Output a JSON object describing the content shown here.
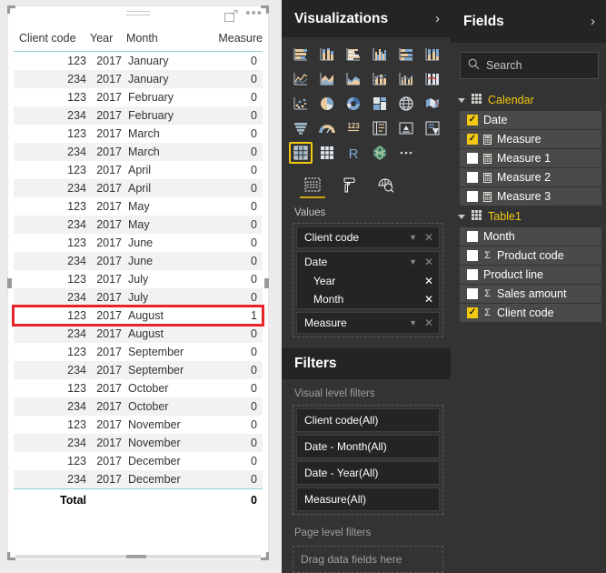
{
  "visual": {
    "name": "table-visual",
    "header_icons": [
      "focus-mode-icon",
      "more-options-icon"
    ],
    "columns": [
      "Client code",
      "Year",
      "Month",
      "Measure"
    ],
    "rows": [
      {
        "client": "123",
        "year": "2017",
        "month": "January",
        "measure": "0",
        "highlighted": false
      },
      {
        "client": "234",
        "year": "2017",
        "month": "January",
        "measure": "0",
        "highlighted": false
      },
      {
        "client": "123",
        "year": "2017",
        "month": "February",
        "measure": "0",
        "highlighted": false
      },
      {
        "client": "234",
        "year": "2017",
        "month": "February",
        "measure": "0",
        "highlighted": false
      },
      {
        "client": "123",
        "year": "2017",
        "month": "March",
        "measure": "0",
        "highlighted": false
      },
      {
        "client": "234",
        "year": "2017",
        "month": "March",
        "measure": "0",
        "highlighted": false
      },
      {
        "client": "123",
        "year": "2017",
        "month": "April",
        "measure": "0",
        "highlighted": false
      },
      {
        "client": "234",
        "year": "2017",
        "month": "April",
        "measure": "0",
        "highlighted": false
      },
      {
        "client": "123",
        "year": "2017",
        "month": "May",
        "measure": "0",
        "highlighted": false
      },
      {
        "client": "234",
        "year": "2017",
        "month": "May",
        "measure": "0",
        "highlighted": false
      },
      {
        "client": "123",
        "year": "2017",
        "month": "June",
        "measure": "0",
        "highlighted": false
      },
      {
        "client": "234",
        "year": "2017",
        "month": "June",
        "measure": "0",
        "highlighted": false
      },
      {
        "client": "123",
        "year": "2017",
        "month": "July",
        "measure": "0",
        "highlighted": false
      },
      {
        "client": "234",
        "year": "2017",
        "month": "July",
        "measure": "0",
        "highlighted": false
      },
      {
        "client": "123",
        "year": "2017",
        "month": "August",
        "measure": "1",
        "highlighted": true
      },
      {
        "client": "234",
        "year": "2017",
        "month": "August",
        "measure": "0",
        "highlighted": false
      },
      {
        "client": "123",
        "year": "2017",
        "month": "September",
        "measure": "0",
        "highlighted": false
      },
      {
        "client": "234",
        "year": "2017",
        "month": "September",
        "measure": "0",
        "highlighted": false
      },
      {
        "client": "123",
        "year": "2017",
        "month": "October",
        "measure": "0",
        "highlighted": false
      },
      {
        "client": "234",
        "year": "2017",
        "month": "October",
        "measure": "0",
        "highlighted": false
      },
      {
        "client": "123",
        "year": "2017",
        "month": "November",
        "measure": "0",
        "highlighted": false
      },
      {
        "client": "234",
        "year": "2017",
        "month": "November",
        "measure": "0",
        "highlighted": false
      },
      {
        "client": "123",
        "year": "2017",
        "month": "December",
        "measure": "0",
        "highlighted": false
      },
      {
        "client": "234",
        "year": "2017",
        "month": "December",
        "measure": "0",
        "highlighted": false
      }
    ],
    "total": {
      "label": "Total",
      "measure": "0"
    },
    "highlight_color": "#e8242a",
    "header_rule_color": "#8fd0d0"
  },
  "visualizations": {
    "title": "Visualizations",
    "collapse_icon": "chevron-right-icon",
    "selected_visual": "table-visual-icon",
    "icons": [
      "stacked-bar-chart-icon",
      "stacked-column-chart-icon",
      "clustered-bar-chart-icon",
      "clustered-column-chart-icon",
      "100-stacked-bar-chart-icon",
      "100-stacked-column-chart-icon",
      "line-chart-icon",
      "area-chart-icon",
      "stacked-area-chart-icon",
      "line-stacked-column-chart-icon",
      "line-clustered-column-chart-icon",
      "ribbon-chart-icon",
      "scatter-chart-icon",
      "pie-chart-icon",
      "donut-chart-icon",
      "treemap-icon",
      "map-icon",
      "filled-map-icon",
      "funnel-chart-icon",
      "gauge-icon",
      "card-icon",
      "multi-row-card-icon",
      "kpi-icon",
      "slicer-icon",
      "table-visual-icon",
      "matrix-visual-icon",
      "r-script-visual-icon",
      "python-visual-icon",
      "more-visuals-icon"
    ],
    "well_tabs": [
      {
        "name": "fields-tab",
        "icon": "fields-pane-icon",
        "active": true
      },
      {
        "name": "format-tab",
        "icon": "paint-roller-icon",
        "active": false
      },
      {
        "name": "analytics-tab",
        "icon": "magnifier-chart-icon",
        "active": false
      }
    ],
    "values_label": "Values",
    "values": [
      {
        "label": "Client code",
        "type": "chip",
        "has_caret": true,
        "has_remove": true
      },
      {
        "label": "Date",
        "type": "group",
        "has_caret": true,
        "has_remove": true,
        "children": [
          {
            "label": "Year",
            "has_remove": true
          },
          {
            "label": "Month",
            "has_remove": true
          }
        ]
      },
      {
        "label": "Measure",
        "type": "chip",
        "has_caret": true,
        "has_remove": true
      }
    ]
  },
  "filters": {
    "title": "Filters",
    "visual_level_label": "Visual level filters",
    "visual_level_items": [
      "Client code(All)",
      "Date - Month(All)",
      "Date - Year(All)",
      "Measure(All)"
    ],
    "page_level_label": "Page level filters",
    "page_level_placeholder": "Drag data fields here"
  },
  "fields": {
    "title": "Fields",
    "collapse_icon": "chevron-right-icon",
    "search": {
      "placeholder": "Search",
      "value": "",
      "icon": "search-icon"
    },
    "tables": [
      {
        "name": "Calendar",
        "expanded": true,
        "icon": "table-icon",
        "items": [
          {
            "label": "Date",
            "checked": true,
            "measure_icon": false,
            "sigma": false
          },
          {
            "label": "Measure",
            "checked": true,
            "measure_icon": true,
            "sigma": false
          },
          {
            "label": "Measure 1",
            "checked": false,
            "measure_icon": true,
            "sigma": false
          },
          {
            "label": "Measure 2",
            "checked": false,
            "measure_icon": true,
            "sigma": false
          },
          {
            "label": "Measure 3",
            "checked": false,
            "measure_icon": true,
            "sigma": false
          }
        ]
      },
      {
        "name": "Table1",
        "expanded": true,
        "icon": "table-icon",
        "items": [
          {
            "label": "Month",
            "checked": false,
            "measure_icon": false,
            "sigma": false
          },
          {
            "label": "Product code",
            "checked": false,
            "measure_icon": false,
            "sigma": true
          },
          {
            "label": "Product line",
            "checked": false,
            "measure_icon": false,
            "sigma": false
          },
          {
            "label": "Sales amount",
            "checked": false,
            "measure_icon": false,
            "sigma": true
          },
          {
            "label": "Client code",
            "checked": true,
            "measure_icon": false,
            "sigma": true
          }
        ]
      }
    ]
  },
  "colors": {
    "accent_yellow": "#f2c811",
    "panel_bg": "#333333",
    "panel_header_bg": "#252423",
    "highlight_red": "#e8242a"
  }
}
